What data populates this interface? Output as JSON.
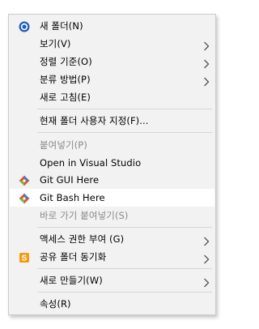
{
  "context_menu": {
    "items": [
      {
        "label": "새 폴더(N)",
        "icon": "new-folder-icon",
        "submenu": false,
        "disabled": false
      },
      {
        "label": "보기(V)",
        "submenu": true,
        "disabled": false
      },
      {
        "label": "정렬 기준(O)",
        "submenu": true,
        "disabled": false
      },
      {
        "label": "분류 방법(P)",
        "submenu": true,
        "disabled": false
      },
      {
        "label": "새로 고침(E)",
        "submenu": false,
        "disabled": false
      },
      {
        "label": "현재 폴더 사용자 지정(F)...",
        "submenu": false,
        "disabled": false
      },
      {
        "label": "붙여넣기(P)",
        "submenu": false,
        "disabled": true
      },
      {
        "label": "Open in Visual Studio",
        "submenu": false,
        "disabled": false
      },
      {
        "label": "Git GUI Here",
        "icon": "git-icon",
        "submenu": false,
        "disabled": false
      },
      {
        "label": "Git Bash Here",
        "icon": "git-icon",
        "submenu": false,
        "disabled": false,
        "hovered": true
      },
      {
        "label": "바로 가기 붙여넣기(S)",
        "submenu": false,
        "disabled": true
      },
      {
        "label": "액세스 권한 부여 (G)",
        "submenu": true,
        "disabled": false
      },
      {
        "label": "공유 폴더 동기화",
        "icon": "sync-s-icon",
        "submenu": true,
        "disabled": false
      },
      {
        "label": "새로 만들기(W)",
        "submenu": true,
        "disabled": false
      },
      {
        "label": "속성(R)",
        "submenu": false,
        "disabled": false
      }
    ]
  },
  "colors": {
    "menu_background": "#f2f2f2",
    "hover_background": "#ffffff",
    "disabled_text": "#8a8a8a",
    "git_orange": "#e94e31",
    "git_green": "#72b84a",
    "git_blue": "#3b7fc4",
    "sync_icon_orange": "#f39c12",
    "new_folder_icon_blue": "#1e5fb8"
  }
}
